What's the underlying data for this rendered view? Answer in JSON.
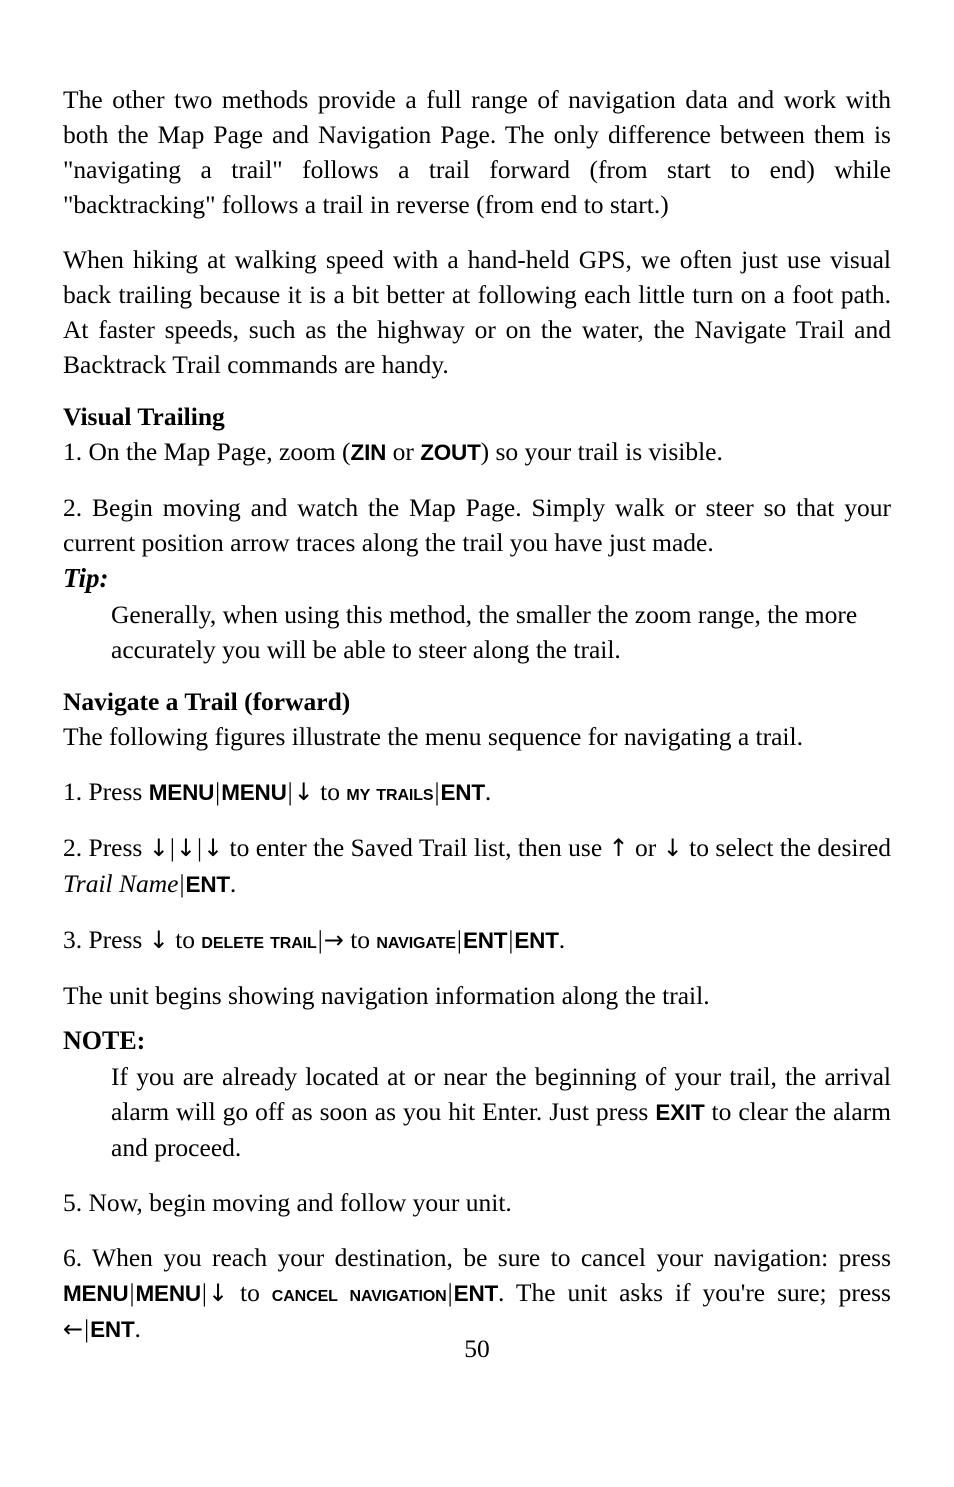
{
  "document": {
    "page_number": "50",
    "body": {
      "para_1": "The other two methods provide a full range of navigation data and work with both the Map Page and Navigation Page. The only difference between them is \"navigating a trail\" follows a trail forward (from start to end) while \"backtracking\" follows a trail in reverse (from end to start.)",
      "para_2": "When hiking at walking speed with a hand-held GPS, we often just use visual back trailing because it is a bit better at following each little turn on a foot path. At faster speeds, such as the highway or on the water, the Navigate Trail and Backtrack Trail commands are handy.",
      "heading_visual_trailing": "Visual Trailing",
      "step_v1_pre": "1. On the Map Page, zoom (",
      "step_v1_key_a": "ZIN",
      "step_v1_mid": " or ",
      "step_v1_key_b": "ZOUT",
      "step_v1_post": ") so your trail is visible.",
      "step_v2": "2. Begin moving and watch the Map Page. Simply walk or steer so that your current position arrow traces along the trail you have just made.",
      "tip_label": "Tip:",
      "tip_body": "Generally, when using this method, the smaller the zoom range, the more accurately you will be able to steer along the trail.",
      "heading_navigate_trail": "Navigate a Trail (forward)",
      "intro_figures": "The following figures illustrate the menu sequence for navigating a trail.",
      "step_1_pre": "1. Press ",
      "step_1_key_menu_a": "MENU",
      "step_1_key_menu_b": "MENU",
      "step_1_arrow_down": "↓",
      "step_1_mid": " to ",
      "step_1_key_mytrails": "My Trails",
      "step_1_key_ent": "ENT",
      "step_1_post": ".",
      "step_2_pre": "2. Press ",
      "step_2_arrow_1": "↓",
      "step_2_arrow_2": "↓",
      "step_2_arrow_3": "↓",
      "step_2_mid": " to enter the Saved Trail list, then use ",
      "step_2_arrow_up": "↑",
      "step_2_or": " or ",
      "step_2_arrow_dn": "↓",
      "step_2_tail": " to select the desired ",
      "step_2_italic": "Trail Name",
      "step_2_key_ent": "ENT",
      "step_2_post": ".",
      "step_3_pre": "3. Press ",
      "step_3_arrow_down": "↓",
      "step_3_mid_1": " to ",
      "step_3_key_delete": "Delete Trail",
      "step_3_arrow_right": "→",
      "step_3_mid_2": " to ",
      "step_3_key_navigate": "Navigate",
      "step_3_key_ent_a": "ENT",
      "step_3_key_ent_b": "ENT",
      "step_3_post": ".",
      "para_unit_begins": "The unit begins showing navigation information along the trail.",
      "note_label": "NOTE:",
      "note_body_pre": "If you are already located at or near the beginning of your trail, the arrival alarm will go off as soon as you hit Enter. Just press ",
      "note_body_key": "EXIT",
      "note_body_post": " to clear the alarm and proceed.",
      "step_5": "5. Now, begin moving and follow your unit.",
      "step_6_pre": "6. When you reach your destination, be sure to cancel your navigation: press ",
      "step_6_key_menu_a": "MENU",
      "step_6_key_menu_b": "MENU",
      "step_6_arrow_down": "↓",
      "step_6_mid": " to ",
      "step_6_key_cancel": "Cancel Navigation",
      "step_6_key_ent_a": "ENT",
      "step_6_post": ". The unit asks if you're sure; press ",
      "step_6_arrow_left": "←",
      "step_6_key_ent_b": "ENT",
      "step_6_end": "."
    }
  }
}
